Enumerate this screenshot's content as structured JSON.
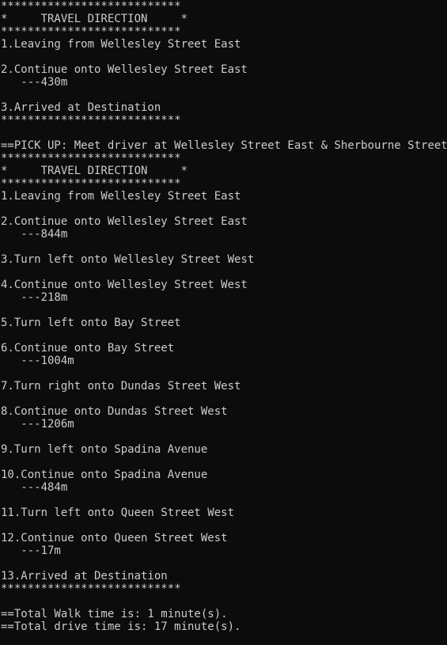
{
  "console": {
    "lines": [
      "***************************",
      "*     TRAVEL DIRECTION     *",
      "***************************",
      "1.Leaving from Wellesley Street East",
      "",
      "2.Continue onto Wellesley Street East",
      "   ---430m",
      "",
      "3.Arrived at Destination",
      "***************************",
      "",
      "==PICK UP: Meet driver at Wellesley Street East & Sherbourne Street.",
      "***************************",
      "*     TRAVEL DIRECTION     *",
      "***************************",
      "1.Leaving from Wellesley Street East",
      "",
      "2.Continue onto Wellesley Street East",
      "   ---844m",
      "",
      "3.Turn left onto Wellesley Street West",
      "",
      "4.Continue onto Wellesley Street West",
      "   ---218m",
      "",
      "5.Turn left onto Bay Street",
      "",
      "6.Continue onto Bay Street",
      "   ---1004m",
      "",
      "7.Turn right onto Dundas Street West",
      "",
      "8.Continue onto Dundas Street West",
      "   ---1206m",
      "",
      "9.Turn left onto Spadina Avenue",
      "",
      "10.Continue onto Spadina Avenue",
      "   ---484m",
      "",
      "11.Turn left onto Queen Street West",
      "",
      "12.Continue onto Queen Street West",
      "   ---17m",
      "",
      "13.Arrived at Destination",
      "***************************",
      "",
      "==Total Walk time is: 1 minute(s).",
      "==Total drive time is: 17 minute(s)."
    ]
  },
  "colors": {
    "background": "#0c0c0c",
    "text": "#cccccc"
  }
}
